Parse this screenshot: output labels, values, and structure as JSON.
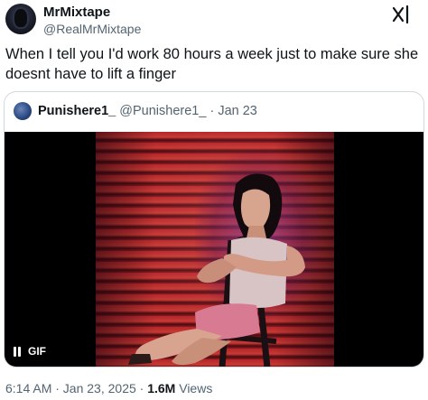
{
  "tweet": {
    "author": {
      "display_name": "MrMixtape",
      "handle": "@RealMrMixtape"
    },
    "text": "When I tell you I'd work 80 hours  a week just to make sure she doesnt have to lift a finger",
    "timestamp": "6:14 AM · Jan 23, 2025",
    "separator": " · ",
    "views_count": "1.6M",
    "views_label": " Views"
  },
  "quoted_tweet": {
    "display_name": "Punishere1_",
    "handle": "@Punishere1_",
    "dot": " · ",
    "date": "Jan 23",
    "media": {
      "badge": "GIF",
      "playback_icon": "pause-icon"
    }
  },
  "icons": {
    "top_right": "grok-icon"
  },
  "colors": {
    "text_primary": "#0f1419",
    "text_secondary": "#536471",
    "border": "#cfd9de"
  }
}
